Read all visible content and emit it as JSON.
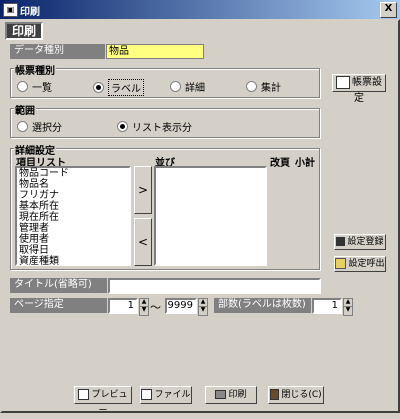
{
  "window": {
    "title": "印刷",
    "close_label": "X"
  },
  "header": {
    "badge": "印刷"
  },
  "data_kind": {
    "label": "データ種別",
    "value": "物品"
  },
  "report_type": {
    "title": "帳票種別",
    "options": [
      "一覧",
      "ラベル",
      "詳細",
      "集計"
    ],
    "selected": "ラベル"
  },
  "range": {
    "title": "範囲",
    "options": [
      "選択分",
      "リスト表示分"
    ],
    "selected": "リスト表示分"
  },
  "detail": {
    "title": "詳細設定",
    "items_header": "項目リスト",
    "order_header": "並び",
    "page_header": "改頁",
    "subtotal_header": "小計",
    "items": [
      "物品コード",
      "物品名",
      "フリガナ",
      "基本所在",
      "現在所在",
      "管理者",
      "使用者",
      "取得日",
      "資産種類"
    ],
    "add_label": ">",
    "remove_label": "<"
  },
  "buttons": {
    "report_settings": "帳票設定",
    "save_settings": "設定登録",
    "load_settings": "設定呼出",
    "preview": "プレビュー",
    "file": "ファイル",
    "print": "印刷",
    "close": "閉じる(C)"
  },
  "title_field": {
    "label": "タイトル(省略可)",
    "value": ""
  },
  "page_spec": {
    "label": "ページ指定",
    "from": "1",
    "tilde": "〜",
    "to": "9999"
  },
  "copies": {
    "label": "部数(ラベルは枚数)",
    "value": "1"
  }
}
